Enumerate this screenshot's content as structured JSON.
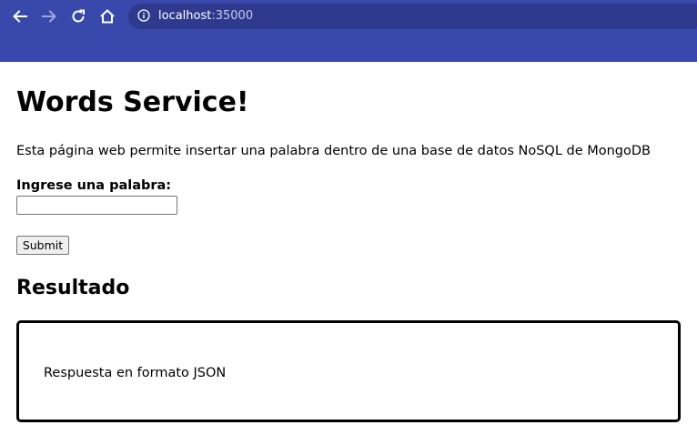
{
  "browser": {
    "url_host": "localhost",
    "url_port": ":35000",
    "bar_color": "#3949ab",
    "icons": [
      "back-arrow-icon",
      "forward-arrow-icon",
      "reload-icon",
      "home-icon",
      "info-icon"
    ]
  },
  "page": {
    "title": "Words Service!",
    "description": "Esta página web permite insertar una palabra dentro de una base de datos NoSQL de MongoDB",
    "form": {
      "label": "Ingrese una palabra:",
      "input_value": "",
      "submit_label": "Submit"
    },
    "result": {
      "heading": "Resultado",
      "text": "Respuesta en formato JSON"
    }
  }
}
